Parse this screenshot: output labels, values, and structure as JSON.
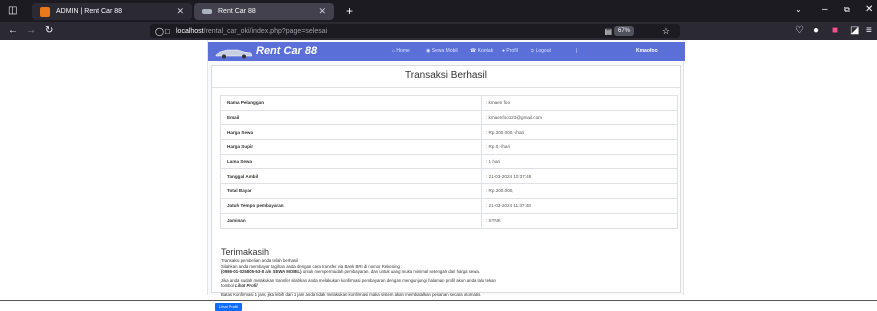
{
  "browser": {
    "tabs": [
      {
        "label": "ADMIN | Rent Car 88"
      },
      {
        "label": "Rent Car 88"
      }
    ],
    "new_tab": "+",
    "url_host": "localhost",
    "url_path": "/rental_car_oki/index.php?page=selesai",
    "zoom": "67%"
  },
  "app": {
    "brand": "Rent Car 88",
    "menu": [
      {
        "label": "Home"
      },
      {
        "label": "Sewa Mobil"
      },
      {
        "label": "Kontak"
      },
      {
        "label": "Profil"
      },
      {
        "label": "Logout"
      }
    ],
    "user": "Kmaofoo"
  },
  "card": {
    "title": "Transaksi Berhasil",
    "rows": [
      {
        "label": "Nama Pelanggan",
        "value": ": kmaen foo"
      },
      {
        "label": "Email",
        "value": ": kmaenfoo123@gmail.com"
      },
      {
        "label": "Harga Sewa",
        "value": ": Rp.200.000,-/hari"
      },
      {
        "label": "Harga Supir",
        "value": ": Rp.0,-/hari"
      },
      {
        "label": "Lama Sewa",
        "value": ": 1 hari"
      },
      {
        "label": "Tanggal Ambil",
        "value": ": 21-03-2024 10:37:48"
      },
      {
        "label": "Total Bayar",
        "value": ": Rp.200.000,"
      },
      {
        "label": "Jatuh Tempo pembayaran",
        "value": ": 21-03-2024 11:37:48"
      },
      {
        "label": "Jaminan",
        "value": ": STNK"
      }
    ]
  },
  "thanks": {
    "heading": "Terimakasih",
    "line1": "Transaksi pembelian anda telah berhasil",
    "line2": "Silahkan anda membayar tagihan anda dengan cara transfer via Bank BRI di nomor Rekening :",
    "line3_bold": "(0986-01-025805-53-8 a/n SEWA MOBIL)",
    "line3_rest": " untuk mempermudah pembayaran, dan untuk uang muka minimal setengah dari harga sewa.",
    "line4": "Jika anda sudah melakukan transfer silahkan anda melakukan konfirmasi pembayaran dengan mengunjungi halaman profil akun anda lalu tekan",
    "line5_pre": "tombol ",
    "line5_bold": "Lihat Profil",
    "line6": "Batas Konfirmasi 1 jam, jika lebih dari 1 jam anda tidak melakukan konfirmasi maka sistem akan membatalkan pesanan secara otomatis.",
    "button": "Lihat Profil"
  }
}
